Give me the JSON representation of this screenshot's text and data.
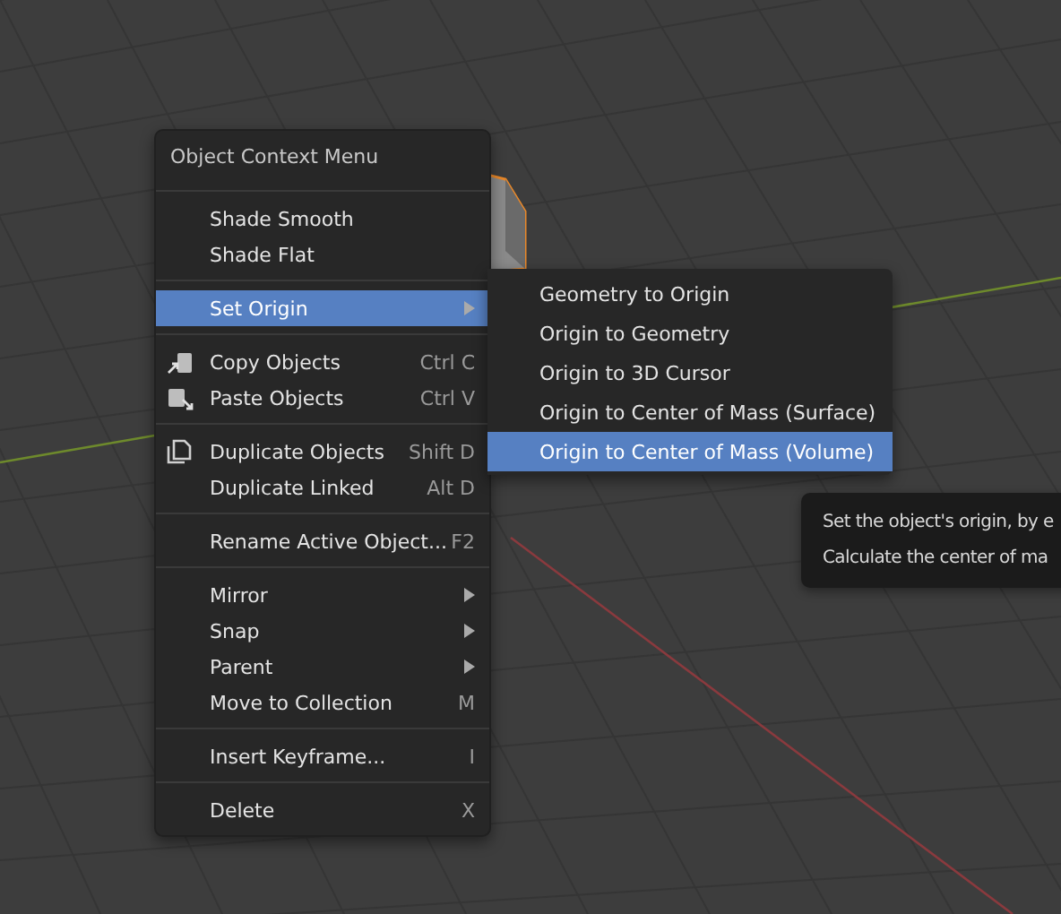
{
  "context_menu": {
    "title": "Object Context Menu",
    "items": [
      {
        "kind": "separator"
      },
      {
        "kind": "plain",
        "label": "Shade Smooth",
        "selected": false
      },
      {
        "kind": "plain",
        "label": "Shade Flat",
        "selected": false
      },
      {
        "kind": "separator"
      },
      {
        "kind": "plain",
        "label": "Set Origin",
        "submenu": true,
        "selected": true
      },
      {
        "kind": "separator"
      },
      {
        "kind": "copy",
        "label": "Copy Objects",
        "shortcut": "Ctrl C",
        "selected": false
      },
      {
        "kind": "paste",
        "label": "Paste Objects",
        "shortcut": "Ctrl V",
        "selected": false
      },
      {
        "kind": "separator"
      },
      {
        "kind": "duplicate",
        "label": "Duplicate Objects",
        "shortcut": "Shift D",
        "selected": false
      },
      {
        "kind": "plain",
        "label": "Duplicate Linked",
        "shortcut": "Alt D",
        "selected": false
      },
      {
        "kind": "separator"
      },
      {
        "kind": "plain",
        "label": "Rename Active Object...",
        "shortcut": "F2",
        "selected": false
      },
      {
        "kind": "separator"
      },
      {
        "kind": "plain",
        "label": "Mirror",
        "submenu": true,
        "selected": false
      },
      {
        "kind": "plain",
        "label": "Snap",
        "submenu": true,
        "selected": false
      },
      {
        "kind": "plain",
        "label": "Parent",
        "submenu": true,
        "selected": false
      },
      {
        "kind": "plain",
        "label": "Move to Collection",
        "shortcut": "M",
        "selected": false
      },
      {
        "kind": "separator"
      },
      {
        "kind": "plain",
        "label": "Insert Keyframe...",
        "shortcut": "I",
        "selected": false
      },
      {
        "kind": "separator"
      },
      {
        "kind": "plain",
        "label": "Delete",
        "shortcut": "X",
        "selected": false
      }
    ]
  },
  "submenu": {
    "items": [
      {
        "label": "Geometry to Origin",
        "selected": false
      },
      {
        "label": "Origin to Geometry",
        "selected": false
      },
      {
        "label": "Origin to 3D Cursor",
        "selected": false
      },
      {
        "label": "Origin to Center of Mass (Surface)",
        "selected": false
      },
      {
        "label": "Origin to Center of Mass (Volume)",
        "selected": true
      }
    ]
  },
  "tooltip": {
    "lines": [
      "Set the object's origin, by e",
      "Calculate the center of ma"
    ]
  }
}
